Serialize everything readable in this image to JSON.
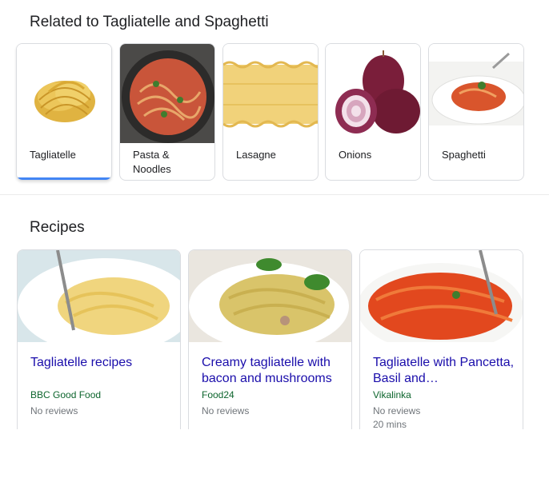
{
  "related": {
    "title": "Related to Tagliatelle and Spaghetti",
    "items": [
      {
        "label": "Tagliatelle",
        "selected": true
      },
      {
        "label": "Pasta & Noodles"
      },
      {
        "label": "Lasagne"
      },
      {
        "label": "Onions"
      },
      {
        "label": "Spaghetti"
      }
    ]
  },
  "recipes": {
    "title": "Recipes",
    "items": [
      {
        "title": "Tagliatelle recipes",
        "source": "BBC Good Food",
        "reviews": "No reviews",
        "time": ""
      },
      {
        "title": "Creamy tagliatelle with bacon and mushrooms",
        "source": "Food24",
        "reviews": "No reviews",
        "time": ""
      },
      {
        "title": "Tagliatelle with Pancetta, Basil and…",
        "source": "Vikalinka",
        "reviews": "No reviews",
        "time": "20 mins"
      }
    ]
  },
  "colors": {
    "link_title": "#1a0dab",
    "source_green": "#0d652d",
    "meta_gray": "#70757a",
    "selected_bar": "#4285f4"
  }
}
